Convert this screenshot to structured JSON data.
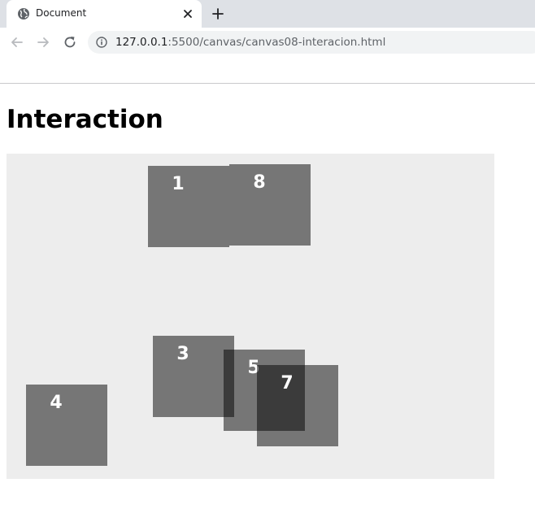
{
  "browser": {
    "tab": {
      "title": "Document",
      "favicon": "globe-icon",
      "close_icon": "close-icon"
    },
    "new_tab_icon": "plus-icon",
    "nav": {
      "back_icon": "back-arrow-icon",
      "forward_icon": "forward-arrow-icon",
      "reload_icon": "reload-icon"
    },
    "address_bar": {
      "info_icon": "info-icon",
      "url_host": "127.0.0.1",
      "url_path": ":5500/canvas/canvas08-interacion.html"
    }
  },
  "page": {
    "heading": "Interaction",
    "canvas": {
      "background": "#ededed",
      "square_color": "rgba(0,0,0,0.5)",
      "squares": [
        {
          "label": "1"
        },
        {
          "label": "8"
        },
        {
          "label": "3"
        },
        {
          "label": "5"
        },
        {
          "label": "7"
        },
        {
          "label": "4"
        }
      ]
    }
  }
}
